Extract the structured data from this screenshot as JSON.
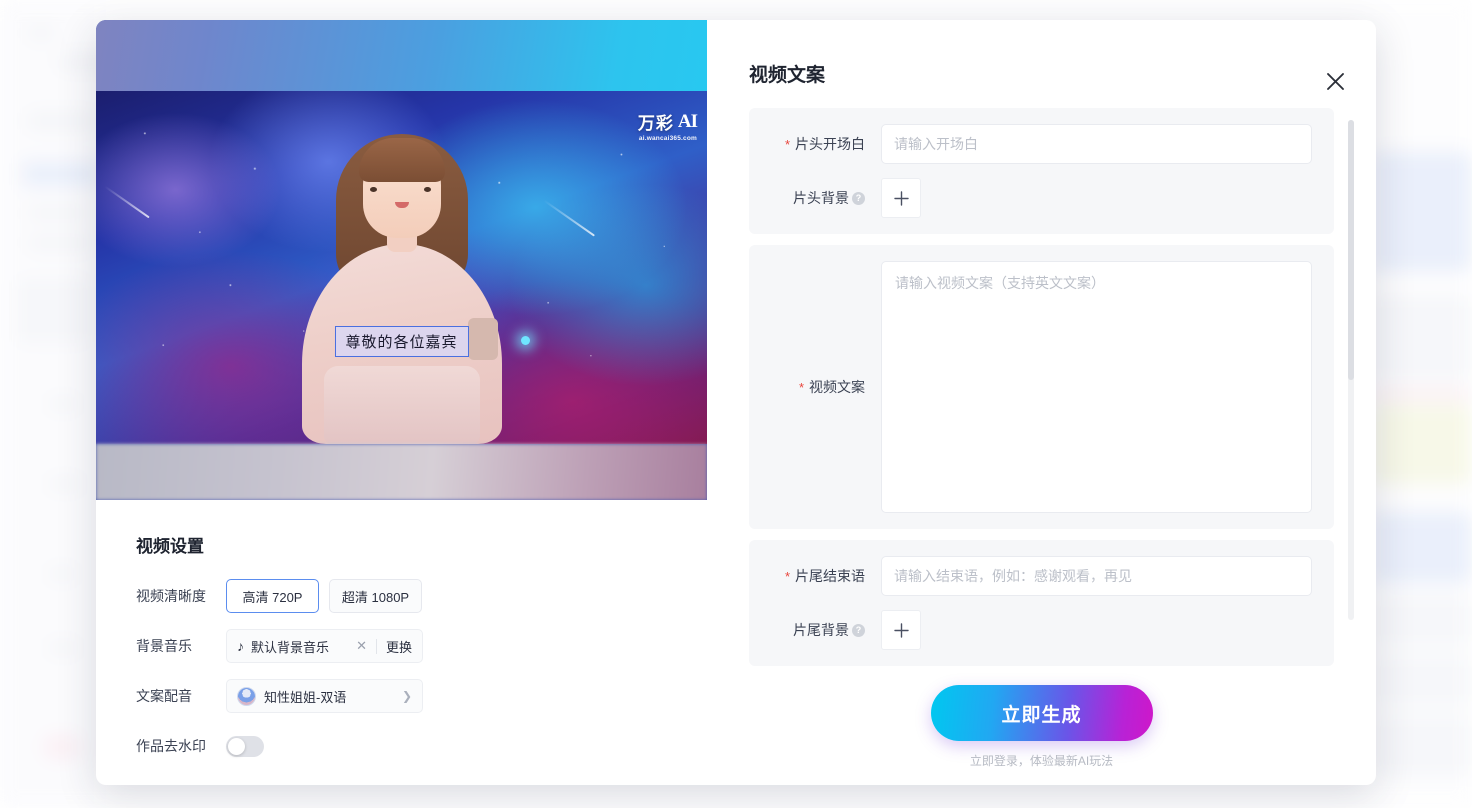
{
  "background": {
    "description": "blurred application page behind modal"
  },
  "preview": {
    "watermark_brand": "万彩",
    "watermark_ai": "AI",
    "watermark_url": "ai.wancai365.com",
    "subtitle": "尊敬的各位嘉宾"
  },
  "settings": {
    "title": "视频设置",
    "resolution": {
      "label": "视频清晰度",
      "options": [
        {
          "label": "高清 720P",
          "selected": true
        },
        {
          "label": "超清 1080P",
          "selected": false
        }
      ]
    },
    "music": {
      "label": "背景音乐",
      "value": "默认背景音乐",
      "note_icon": "music-note-icon",
      "clear_icon": "close-icon",
      "change_label": "更换"
    },
    "voice": {
      "label": "文案配音",
      "value": "知性姐姐-双语",
      "chevron": "chevron-right-icon"
    },
    "watermark_toggle": {
      "label": "作品去水印",
      "enabled": false
    }
  },
  "panel": {
    "title": "视频文案",
    "close_icon": "close-icon",
    "opening": {
      "label": "片头开场白",
      "required": true,
      "placeholder": "请输入开场白",
      "value": ""
    },
    "opening_bg": {
      "label": "片头背景",
      "help_icon": "question-icon",
      "add_icon": "plus-icon"
    },
    "script": {
      "label": "视频文案",
      "required": true,
      "placeholder": "请输入视频文案（支持英文文案）",
      "value": ""
    },
    "ending": {
      "label": "片尾结束语",
      "required": true,
      "placeholder": "请输入结束语，例如：感谢观看，再见",
      "value": ""
    },
    "ending_bg": {
      "label": "片尾背景",
      "help_icon": "question-icon",
      "add_icon": "plus-icon"
    },
    "generate_label": "立即生成",
    "login_hint": "立即登录，体验最新AI玩法"
  },
  "colors": {
    "accent_blue": "#5b8def",
    "required_red": "#e8453c",
    "cta_gradient_start": "#00c8f0",
    "cta_gradient_end": "#cf17c9",
    "group_bg": "#f6f7f9"
  }
}
